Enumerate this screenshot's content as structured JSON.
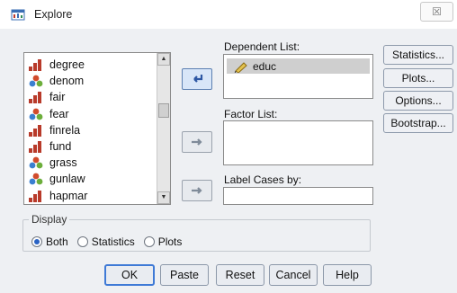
{
  "window": {
    "title": "Explore",
    "close_glyph": "☒"
  },
  "variables": {
    "items": [
      {
        "name": "degree",
        "icon": "ordinal-bar-icon"
      },
      {
        "name": "denom",
        "icon": "nominal-circles-icon"
      },
      {
        "name": "fair",
        "icon": "ordinal-bar-icon"
      },
      {
        "name": "fear",
        "icon": "nominal-circles-icon"
      },
      {
        "name": "finrela",
        "icon": "ordinal-bar-icon"
      },
      {
        "name": "fund",
        "icon": "ordinal-bar-icon"
      },
      {
        "name": "grass",
        "icon": "nominal-circles-icon"
      },
      {
        "name": "gunlaw",
        "icon": "nominal-circles-icon"
      },
      {
        "name": "hapmar",
        "icon": "ordinal-bar-icon"
      }
    ]
  },
  "dependent": {
    "label": "Dependent List:",
    "items": [
      "educ"
    ]
  },
  "factor": {
    "label": "Factor List:"
  },
  "label_cases": {
    "label": "Label Cases by:"
  },
  "side_buttons": [
    "Statistics...",
    "Plots...",
    "Options...",
    "Bootstrap..."
  ],
  "display": {
    "title": "Display",
    "options": [
      "Both",
      "Statistics",
      "Plots"
    ],
    "selected": "Both"
  },
  "bottom_buttons": [
    "OK",
    "Paste",
    "Reset",
    "Cancel",
    "Help"
  ],
  "colors": {
    "accent": "#2a63c4",
    "ordinal_bar": "#b83a2a",
    "nominal_a": "#d14b2c",
    "nominal_b": "#3a7fd0",
    "nominal_c": "#6cae3b",
    "scale_pencil": "#d9b33a"
  }
}
